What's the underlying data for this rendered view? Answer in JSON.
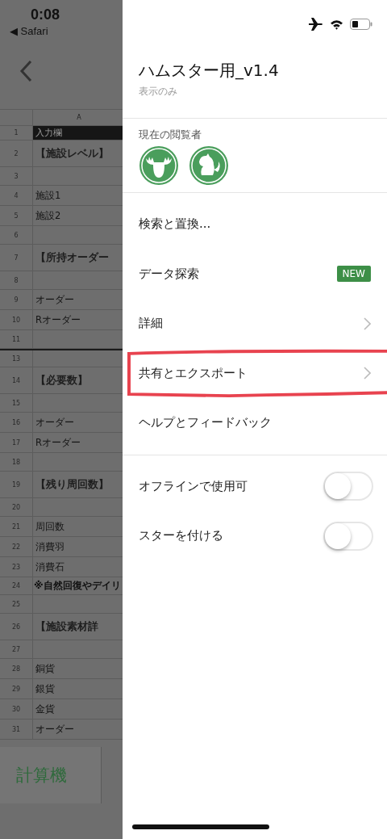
{
  "status_bar": {
    "time": "0:08",
    "back_app": "◀ Safari"
  },
  "sheet": {
    "column_header": "A",
    "rows": [
      {
        "number": "1",
        "text": "入力欄",
        "kind": "header"
      },
      {
        "number": "2",
        "text": "【施設レベル】",
        "kind": "title"
      },
      {
        "number": "3",
        "kind": "empty"
      },
      {
        "number": "4",
        "text": "施設1",
        "kind": "normal"
      },
      {
        "number": "5",
        "text": "施設2",
        "kind": "normal"
      },
      {
        "number": "6",
        "kind": "empty"
      },
      {
        "number": "7",
        "text": "【所持オーダー",
        "kind": "title"
      },
      {
        "number": "8",
        "kind": "empty"
      },
      {
        "number": "9",
        "text": "オーダー",
        "kind": "normal"
      },
      {
        "number": "10",
        "text": "Rオーダー",
        "kind": "normal"
      },
      {
        "number": "11",
        "kind": "empty"
      },
      {
        "number": "13",
        "kind": "empty"
      },
      {
        "number": "14",
        "text": "【必要数】",
        "kind": "title"
      },
      {
        "number": "15",
        "kind": "empty"
      },
      {
        "number": "16",
        "text": "オーダー",
        "kind": "normal"
      },
      {
        "number": "17",
        "text": "Rオーダー",
        "kind": "normal"
      },
      {
        "number": "18",
        "kind": "empty"
      },
      {
        "number": "19",
        "text": "【残り周回数】",
        "kind": "title"
      },
      {
        "number": "20",
        "kind": "empty"
      },
      {
        "number": "21",
        "text": "周回数",
        "kind": "normal"
      },
      {
        "number": "22",
        "text": "消費羽",
        "kind": "normal"
      },
      {
        "number": "23",
        "text": "消費石",
        "kind": "normal"
      },
      {
        "number": "24",
        "text": "※自然回復やデイリ",
        "kind": "note"
      },
      {
        "number": "25",
        "kind": "empty"
      },
      {
        "number": "26",
        "text": "【施設素材詳",
        "kind": "title"
      },
      {
        "number": "27",
        "kind": "empty"
      },
      {
        "number": "28",
        "text": "銅貨",
        "kind": "normal"
      },
      {
        "number": "29",
        "text": "銀貨",
        "kind": "normal"
      },
      {
        "number": "30",
        "text": "金貨",
        "kind": "normal"
      },
      {
        "number": "31",
        "text": "オーダー",
        "kind": "normal"
      }
    ]
  },
  "calculator_tab": "計算機",
  "drawer": {
    "title": "ハムスター用_v1.4",
    "subtitle": "表示のみ",
    "viewers_label": "現在の閲覧者",
    "viewers": [
      {
        "kind": "moose"
      },
      {
        "kind": "rodent"
      }
    ],
    "menu": [
      {
        "label": "検索と置換...",
        "kind": "plain",
        "highlighted": false
      },
      {
        "label": "データ探索",
        "kind": "badge",
        "badge": "NEW",
        "highlighted": false
      },
      {
        "label": "詳細",
        "kind": "submenu",
        "highlighted": false
      },
      {
        "label": "共有とエクスポート",
        "kind": "submenu",
        "highlighted": true
      },
      {
        "label": "ヘルプとフィードバック",
        "kind": "plain",
        "highlighted": false
      }
    ],
    "toggles": [
      {
        "label": "オフラインで使用可",
        "on": false
      },
      {
        "label": "スターを付ける",
        "on": false
      }
    ]
  }
}
